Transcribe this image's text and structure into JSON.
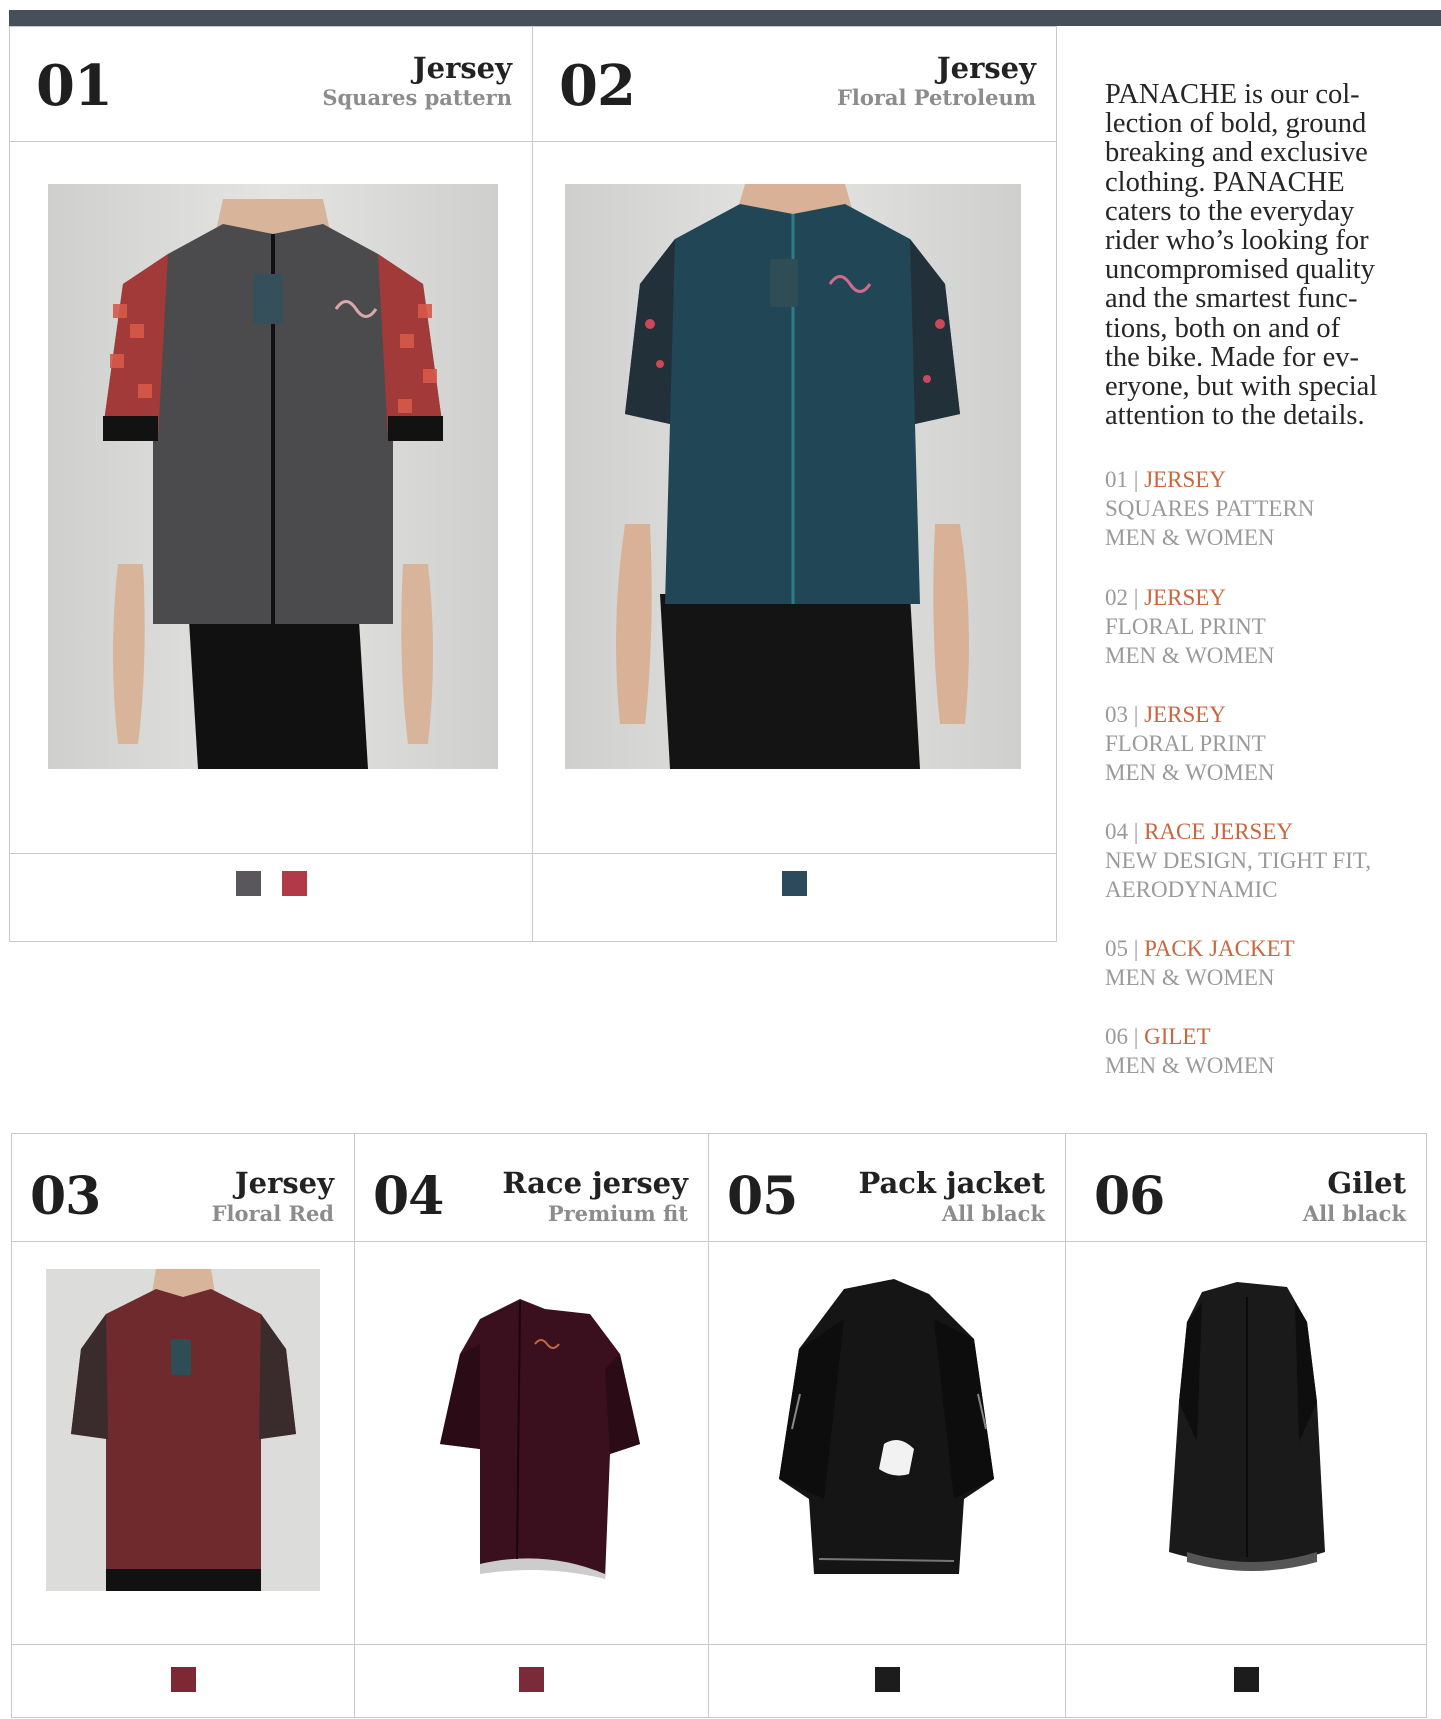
{
  "products_top": [
    {
      "num": "01",
      "title": "Jersey",
      "subtitle": "Squares pattern",
      "image": "gray-jersey-pixel-sleeves-photo",
      "colors": [
        "#5a575c",
        "#b13a48"
      ]
    },
    {
      "num": "02",
      "title": "Jersey",
      "subtitle": "Floral Petroleum",
      "image": "petrol-jersey-floral-sleeves-photo",
      "colors": [
        "#2c4a5c"
      ]
    }
  ],
  "products_bottom": [
    {
      "num": "03",
      "title": "Jersey",
      "subtitle": "Floral Red",
      "image": "red-jersey-photo",
      "colors": [
        "#7d2833"
      ]
    },
    {
      "num": "04",
      "title": "Race jersey",
      "subtitle": "Premium fit",
      "image": "race-jersey-render",
      "colors": [
        "#7b2a3a"
      ]
    },
    {
      "num": "05",
      "title": "Pack jacket",
      "subtitle": "All black",
      "image": "black-pack-jacket",
      "colors": [
        "#1c1c1c"
      ]
    },
    {
      "num": "06",
      "title": "Gilet",
      "subtitle": "All black",
      "image": "black-gilet",
      "colors": [
        "#1c1c1c"
      ]
    }
  ],
  "intro_lines": [
    "PANACHE is our col-",
    "lection of bold, ground",
    "breaking and exclusive",
    "clothing. PANACHE",
    "caters to the everyday",
    "rider who’s looking for",
    "uncompromised quality",
    "and the smartest func-",
    "tions, both on and of",
    "the bike. Made for ev-",
    "eryone, but with special",
    "attention to the details."
  ],
  "list": [
    {
      "num": "01",
      "name": "JERSEY",
      "lines": [
        "SQUARES PATTERN",
        "MEN & WOMEN"
      ]
    },
    {
      "num": "02",
      "name": "JERSEY",
      "lines": [
        "FLORAL PRINT",
        "MEN & WOMEN"
      ]
    },
    {
      "num": "03",
      "name": "JERSEY",
      "lines": [
        "FLORAL PRINT",
        "MEN & WOMEN"
      ]
    },
    {
      "num": "04",
      "name": "RACE JERSEY",
      "lines": [
        "NEW DESIGN, TIGHT FIT,",
        "AERODYNAMIC"
      ]
    },
    {
      "num": "05",
      "name": "PACK JACKET",
      "lines": [
        "MEN & WOMEN"
      ]
    },
    {
      "num": "06",
      "name": "GILET",
      "lines": [
        "MEN & WOMEN"
      ]
    }
  ],
  "list_separator": "|",
  "colors": {
    "accent": "#c8663e",
    "muted": "#9a9a9a",
    "topbar": "#45505a"
  }
}
